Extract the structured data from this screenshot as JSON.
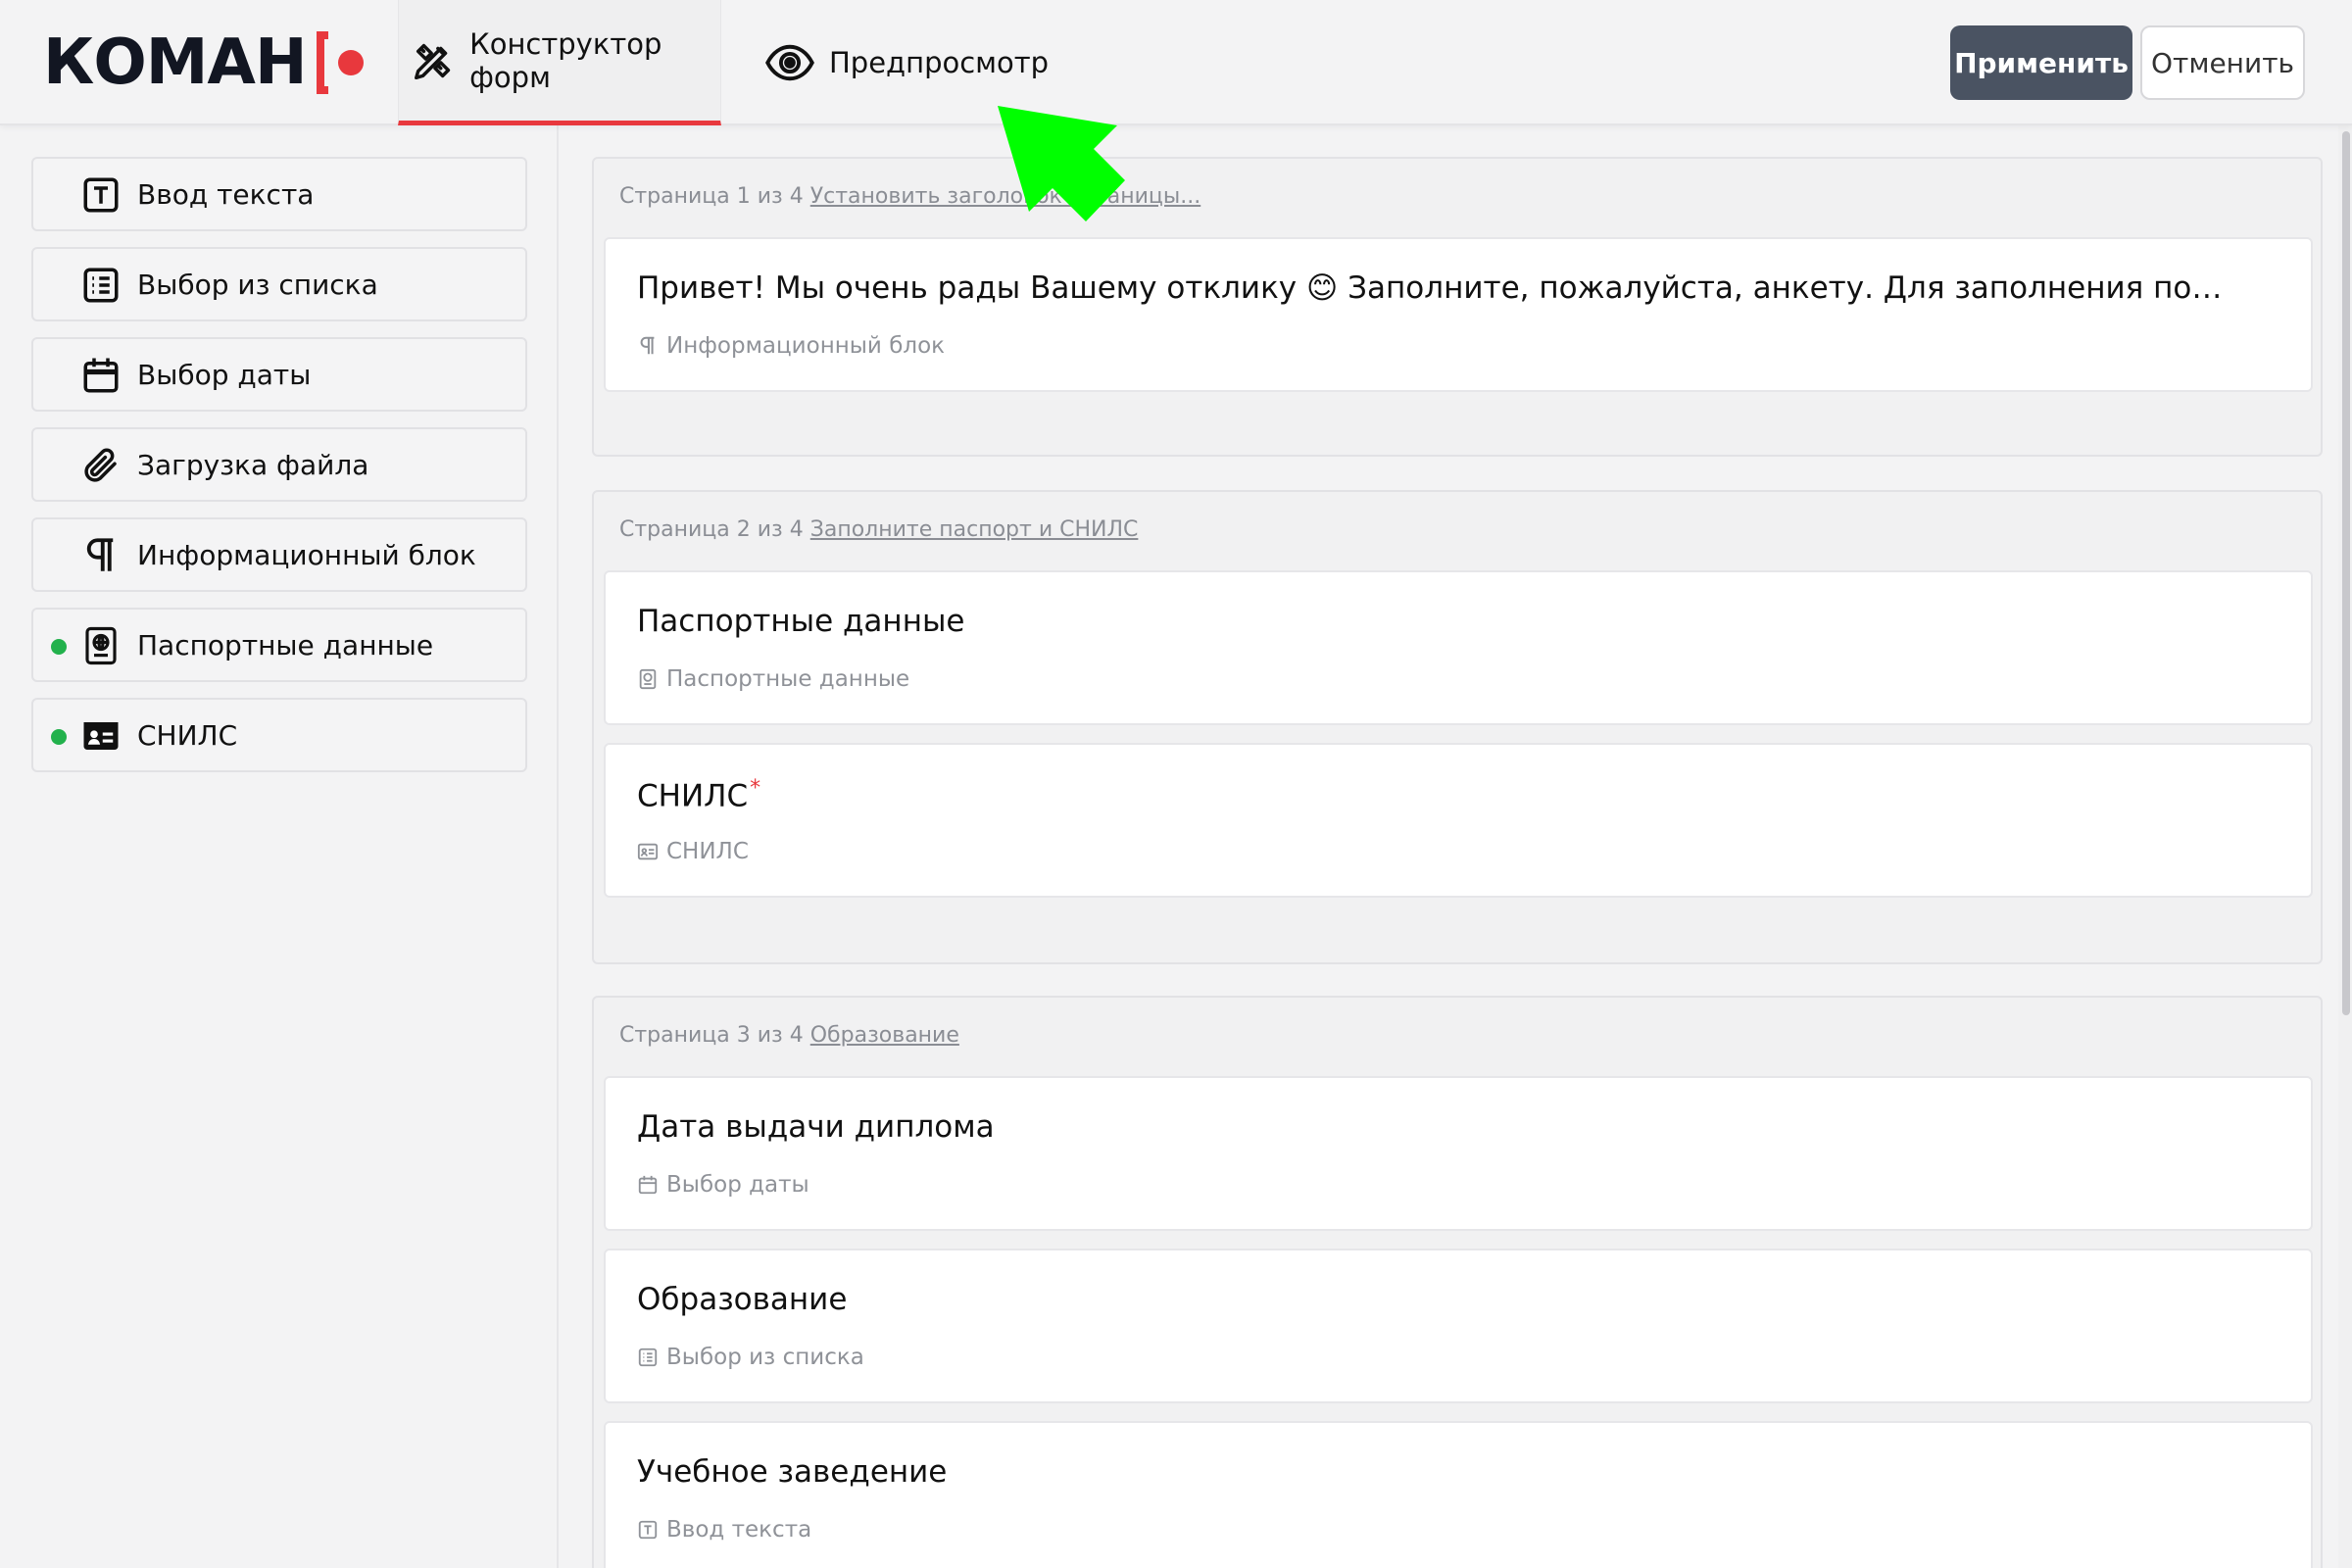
{
  "header": {
    "logo_text": "КОМАН",
    "tabs": [
      {
        "label": "Конструктор форм"
      },
      {
        "label": "Предпросмотр"
      }
    ],
    "apply_label": "Применить",
    "cancel_label": "Отменить"
  },
  "sidebar": {
    "items": [
      {
        "label": "Ввод текста",
        "icon": "text-input-icon"
      },
      {
        "label": "Выбор из списка",
        "icon": "list-icon"
      },
      {
        "label": "Выбор даты",
        "icon": "calendar-icon"
      },
      {
        "label": "Загрузка файла",
        "icon": "paperclip-icon"
      },
      {
        "label": "Информационный блок",
        "icon": "pilcrow-icon"
      },
      {
        "label": "Паспортные данные",
        "icon": "passport-icon",
        "used": true
      },
      {
        "label": "СНИЛС",
        "icon": "id-card-icon",
        "used": true
      }
    ]
  },
  "pages": [
    {
      "counter": "Страница 1 из 4",
      "title_link": "Установить заголовок страницы...",
      "fields": [
        {
          "title": "Привет! Мы очень рады Вашему отклику 😊 Заполните, пожалуйста, анкету. Для заполнения по…",
          "type": "Информационный блок",
          "icon": "pilcrow-icon"
        }
      ]
    },
    {
      "counter": "Страница 2 из 4",
      "title_link": "Заполните паспорт и СНИЛС",
      "fields": [
        {
          "title": "Паспортные данные",
          "type": "Паспортные данные",
          "icon": "passport-icon"
        },
        {
          "title": "СНИЛС",
          "required_mark": "*",
          "type": "СНИЛС",
          "icon": "id-card-icon"
        }
      ]
    },
    {
      "counter": "Страница 3 из 4",
      "title_link": "Образование",
      "fields": [
        {
          "title": "Дата выдачи диплома",
          "type": "Выбор даты",
          "icon": "calendar-icon"
        },
        {
          "title": "Образование",
          "type": "Выбор из списка",
          "icon": "list-icon"
        },
        {
          "title": "Учебное заведение",
          "type": "Ввод текста",
          "icon": "text-input-icon"
        }
      ]
    }
  ],
  "colors": {
    "accent_red": "#e8383d",
    "apply_button": "#4a5362",
    "used_dot": "#22b14c",
    "annotation_arrow": "#00ff00"
  }
}
